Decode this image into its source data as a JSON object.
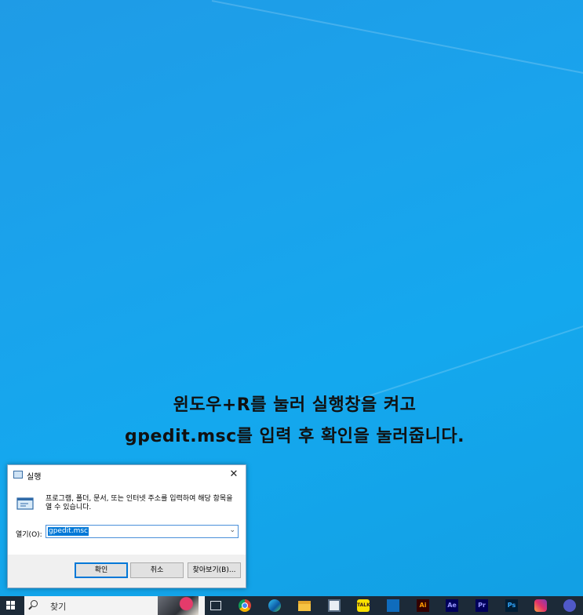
{
  "caption": {
    "line1": "윈도우+R를 눌러 실행창을 켜고",
    "line2": "gpedit.msc를 입력 후 확인을 눌러줍니다."
  },
  "run_dialog": {
    "title": "실행",
    "close_glyph": "✕",
    "description": "프로그램, 폴더, 문서, 또는 인터넷 주소를 입력하여 해당 항목을 열 수 있습니다.",
    "open_label": "열기(O):",
    "input_value": "gpedit.msc",
    "dropdown_glyph": "⌄",
    "ok_label": "확인",
    "cancel_label": "취소",
    "browse_label": "찾아보기(B)..."
  },
  "taskbar": {
    "search_placeholder": "찾기",
    "icons": [
      {
        "name": "task-view-icon",
        "label": ""
      },
      {
        "name": "chrome-icon",
        "label": ""
      },
      {
        "name": "edge-icon",
        "label": ""
      },
      {
        "name": "file-explorer-icon",
        "label": ""
      },
      {
        "name": "store-icon",
        "label": ""
      },
      {
        "name": "kakaotalk-icon",
        "label": "TALK"
      },
      {
        "name": "mail-icon",
        "label": ""
      },
      {
        "name": "illustrator-icon",
        "label": "Ai"
      },
      {
        "name": "after-effects-icon",
        "label": "Ae"
      },
      {
        "name": "premiere-icon",
        "label": "Pr"
      },
      {
        "name": "photoshop-icon",
        "label": "Ps"
      },
      {
        "name": "instagram-icon",
        "label": ""
      },
      {
        "name": "teams-icon",
        "label": ""
      }
    ]
  },
  "colors": {
    "desktop": "#14a8ee",
    "taskbar": "#1c2a38",
    "selection": "#0078d7"
  }
}
